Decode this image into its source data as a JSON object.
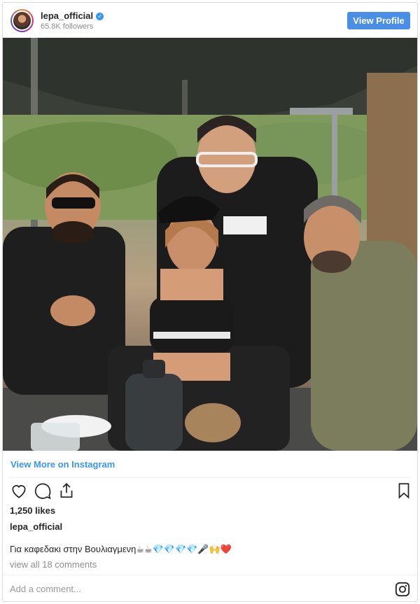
{
  "header": {
    "username": "lepa_official",
    "verified_glyph": "✓",
    "followers": "65.8K followers",
    "view_profile_label": "View Profile"
  },
  "view_more_label": "View More on Instagram",
  "actions": {
    "icons": [
      "heart-icon",
      "comment-icon",
      "share-icon",
      "bookmark-icon"
    ]
  },
  "likes": "1,250 likes",
  "poster": "lepa_official",
  "caption": "Για καφεδακι στην Βουλιαγμενη☕☕💎💎💎💎🎤🙌❤️",
  "comments_link": "view all 18 comments",
  "comment_placeholder": "Add a comment...",
  "colors": {
    "accent": "#3897f0",
    "button": "#4a8fe7",
    "muted": "#8e8e8e",
    "text": "#262626"
  }
}
